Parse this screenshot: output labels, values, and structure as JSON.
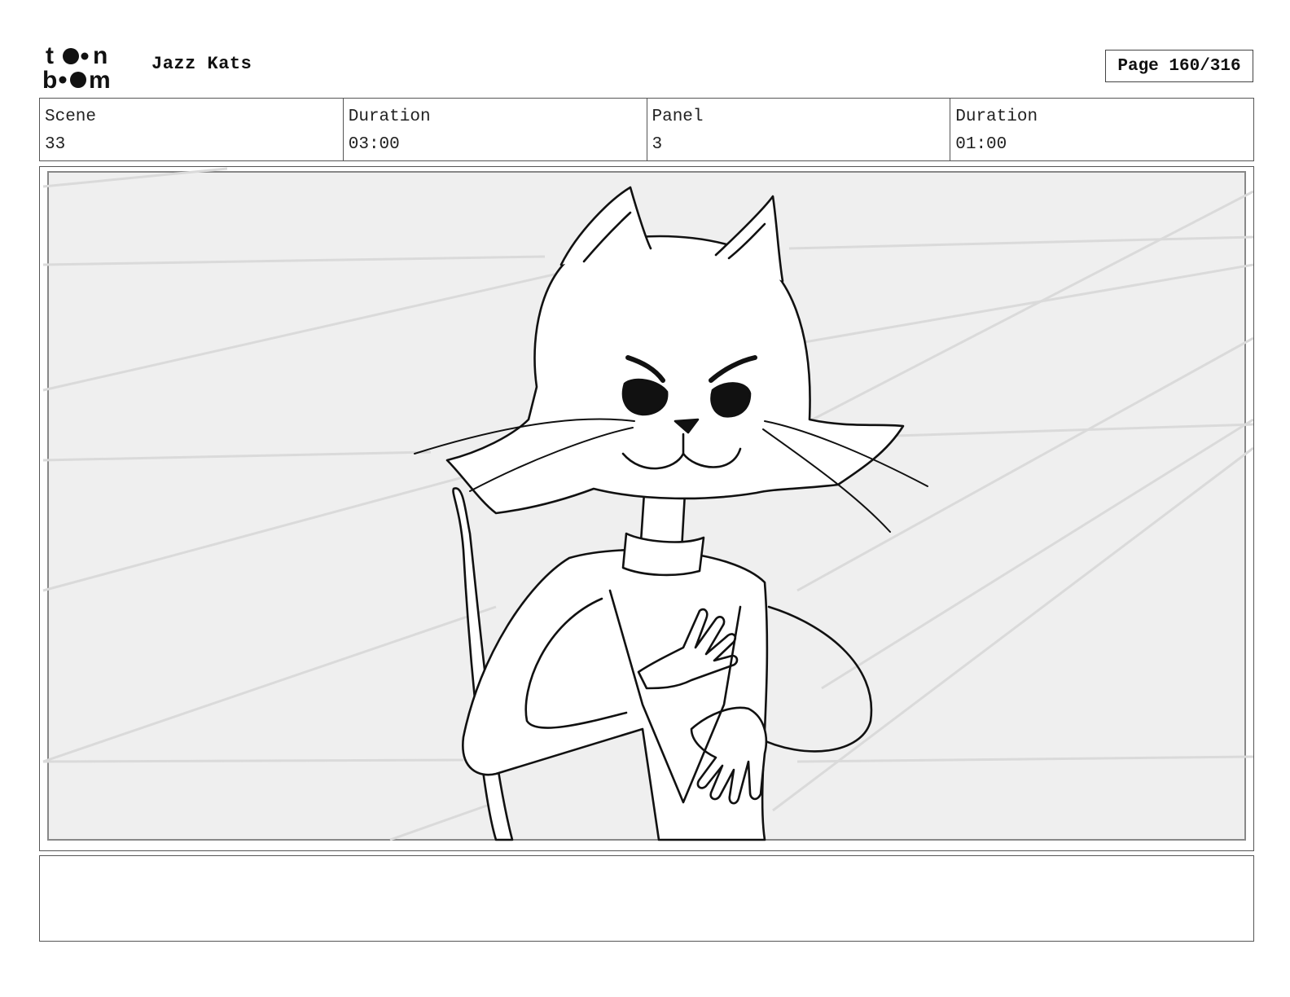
{
  "header": {
    "logo_alt": "toon boom",
    "project_title": "Jazz Kats",
    "page_label": "Page 160/316"
  },
  "info": {
    "scene_label": "Scene",
    "scene_value": "33",
    "scene_duration_label": "Duration",
    "scene_duration_value": "03:00",
    "panel_label": "Panel",
    "panel_value": "3",
    "panel_duration_label": "Duration",
    "panel_duration_value": "01:00"
  },
  "panel": {
    "subject": "cat-character-hand-on-chest"
  },
  "notes": {
    "text": ""
  },
  "colors": {
    "border": "#555555",
    "panel_bg": "#efefef",
    "ink": "#111111"
  }
}
